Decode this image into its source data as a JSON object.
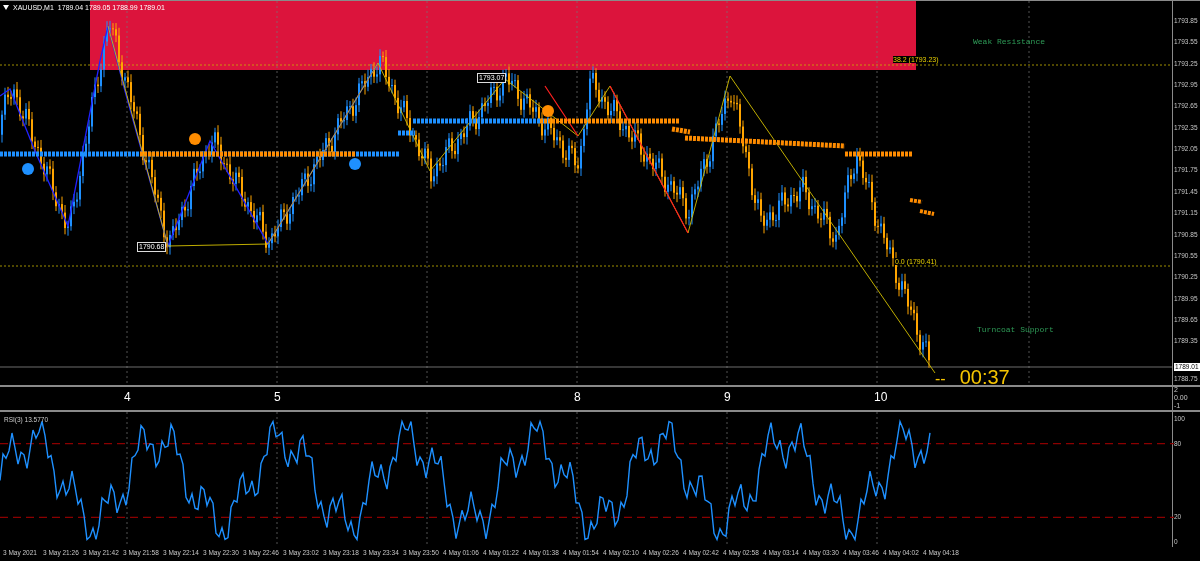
{
  "header": {
    "symbol": "XAUUSD,M1",
    "prices": "1789.04 1789.05 1788.99 1789.01"
  },
  "zones": [
    {
      "kind": "resistance",
      "label": "Weak Resistance"
    },
    {
      "kind": "support",
      "label": "Turncoat Support"
    }
  ],
  "fib_levels": [
    {
      "label": "38.2 (1793.23)"
    },
    {
      "label": "0.0 (1790.41)"
    }
  ],
  "price_tags": [
    {
      "text": "1793.07"
    },
    {
      "text": "1790.68"
    }
  ],
  "timer": {
    "dashes": "--",
    "time": "00:37"
  },
  "price_axis": {
    "ticks": [
      "1793.85",
      "1793.55",
      "1793.25",
      "1792.95",
      "1792.65",
      "1792.35",
      "1792.05",
      "1791.75",
      "1791.45",
      "1791.15",
      "1790.85",
      "1790.55",
      "1790.25",
      "1789.95",
      "1789.65",
      "1789.35",
      "1788.75"
    ],
    "current": "1789.01"
  },
  "sub_panel": {
    "labels": [
      "4",
      "5",
      "8",
      "9",
      "10"
    ],
    "axis": [
      "2",
      "0.00",
      "-1"
    ]
  },
  "rsi": {
    "title": "RSI(3) 13.5770",
    "axis": [
      "100",
      "80",
      "20",
      "0"
    ]
  },
  "time_axis": [
    "3 May 2021",
    "3 May 21:26",
    "3 May 21:42",
    "3 May 21:58",
    "3 May 22:14",
    "3 May 22:30",
    "3 May 22:46",
    "3 May 23:02",
    "3 May 23:18",
    "3 May 23:34",
    "3 May 23:50",
    "4 May 01:06",
    "4 May 01:22",
    "4 May 01:38",
    "4 May 01:54",
    "4 May 02:10",
    "4 May 02:26",
    "4 May 02:42",
    "4 May 02:58",
    "4 May 03:14",
    "4 May 03:30",
    "4 May 03:46",
    "4 May 04:02",
    "4 May 04:18"
  ]
}
